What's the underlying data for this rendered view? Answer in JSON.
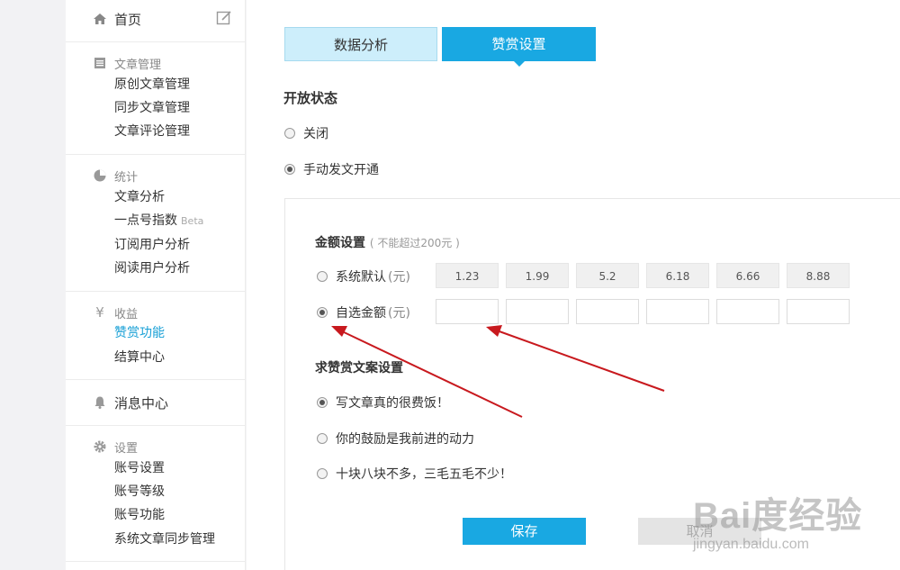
{
  "sidebar": {
    "home": "首页",
    "article_mgmt": {
      "header": "文章管理",
      "items": [
        "原创文章管理",
        "同步文章管理",
        "文章评论管理"
      ]
    },
    "stats": {
      "header": "统计",
      "items": [
        "文章分析",
        "一点号指数",
        "订阅用户分析",
        "阅读用户分析"
      ],
      "beta_label": "Beta"
    },
    "revenue": {
      "header": "收益",
      "items": [
        "赞赏功能",
        "结算中心"
      ]
    },
    "messages": "消息中心",
    "settings": {
      "header": "设置",
      "items": [
        "账号设置",
        "账号等级",
        "账号功能",
        "系统文章同步管理"
      ]
    }
  },
  "tabs": [
    "数据分析",
    "赞赏设置"
  ],
  "open_status": {
    "title": "开放状态",
    "options": [
      "关闭",
      "手动发文开通"
    ],
    "selected": "手动发文开通"
  },
  "amount": {
    "title": "金额设置",
    "note": "( 不能超过200元 )",
    "system_default_label": "系统默认",
    "custom_label": "自选金额",
    "unit": "(元)",
    "presets": [
      "1.23",
      "1.99",
      "5.2",
      "6.18",
      "6.66",
      "8.88"
    ],
    "selected": "自选金额"
  },
  "copy": {
    "title": "求赞赏文案设置",
    "options": [
      "写文章真的很费饭！",
      "你的鼓励是我前进的动力",
      "十块八块不多，三毛五毛不少！"
    ],
    "selected": "写文章真的很费饭！"
  },
  "buttons": {
    "save": "保存",
    "cancel": "取消"
  },
  "watermark": {
    "brand": "Bai度经验",
    "url": "jingyan.baidu.com"
  },
  "colors": {
    "accent": "#19a8e2",
    "active_link": "#19a0d6",
    "arrow": "#c8191e"
  }
}
